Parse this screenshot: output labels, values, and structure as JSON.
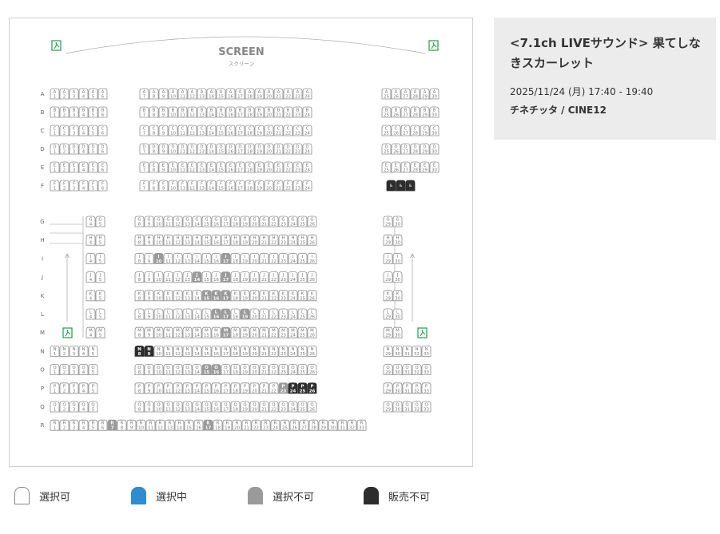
{
  "screen": {
    "title": "SCREEN",
    "subtitle": "スクリーン"
  },
  "rows_top": [
    "A",
    "B",
    "C",
    "D",
    "E",
    "F"
  ],
  "rows_bottom": [
    "G",
    "H",
    "I",
    "J",
    "K",
    "L",
    "M",
    "N",
    "O",
    "P",
    "Q",
    "R"
  ],
  "movie": {
    "title": "<7.1ch LIVEサウンド> 果てしなきスカーレット",
    "datetime": "2025/11/24 (月) 17:40 - 19:40",
    "theater": "チネチッタ / CINE12"
  },
  "legend": [
    {
      "label": "選択可",
      "color": "#ffffff"
    },
    {
      "label": "選択中",
      "color": "#2e8ccf"
    },
    {
      "label": "選択不可",
      "color": "#9a9a9a"
    },
    {
      "label": "販売不可",
      "color": "#2d2d2d"
    }
  ],
  "seat_states": {
    "unavailable": [
      "I10",
      "I17",
      "J14",
      "J17",
      "K15",
      "K16",
      "K17",
      "L16",
      "L17",
      "L19",
      "M17",
      "O15",
      "O16",
      "P23",
      "R7",
      "R17"
    ],
    "sold": [
      "N8",
      "N9",
      "P24",
      "P25",
      "P26",
      "F27",
      "F28",
      "F29"
    ]
  },
  "wheelchair_seats": [
    "F27",
    "F28",
    "F29"
  ],
  "icons": {
    "exit": "emergency-exit-icon",
    "wheelchair": "wheelchair-icon",
    "arrow": "up-arrow-icon"
  }
}
